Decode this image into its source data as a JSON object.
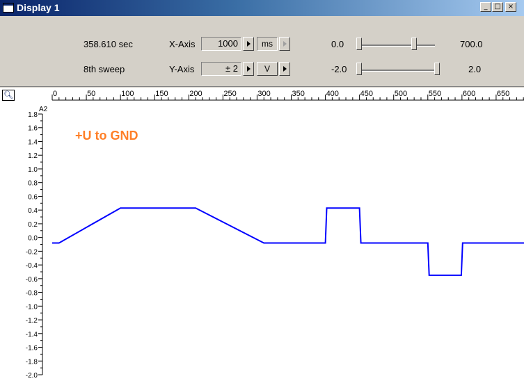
{
  "window": {
    "title": "Display 1",
    "buttons": {
      "minimize": "_",
      "maximize": "□",
      "close": "×"
    }
  },
  "toolbar": {
    "time": "358.610 sec",
    "sweep": "8th sweep",
    "x_axis": {
      "label": "X-Axis",
      "value": "1000",
      "unit": "ms"
    },
    "y_axis": {
      "label": "Y-Axis",
      "value": "± 2",
      "unit": "V"
    },
    "slider1": {
      "min": "0.0",
      "max": "700.0"
    },
    "slider2": {
      "min": "-2.0",
      "max": "2.0"
    }
  },
  "colors": {
    "trace": "#0000ff",
    "annotation": "#ff7f27",
    "accent": "#0a246a"
  },
  "icons": {
    "zoom": "magnifier-icon"
  },
  "chart_data": {
    "type": "line",
    "channel_label": "A2",
    "annotation": "+U to GND",
    "xlim": [
      0,
      700
    ],
    "ylim": [
      -2.0,
      1.8
    ],
    "x_ticks": [
      "0",
      "50",
      "100",
      "150",
      "200",
      "250",
      "300",
      "350",
      "400",
      "450",
      "500",
      "550",
      "600",
      "650"
    ],
    "y_ticks": [
      "1.8",
      "1.6",
      "1.4",
      "1.2",
      "1.0",
      "0.8",
      "0.6",
      "0.4",
      "0.2",
      "0.0",
      "-0.2",
      "-0.4",
      "-0.6",
      "-0.8",
      "-1.0",
      "-1.2",
      "-1.4",
      "-1.6",
      "-1.8",
      "-2.0"
    ],
    "series": [
      {
        "x": [
          0,
          10,
          100,
          210,
          310,
          400,
          402,
          450,
          452,
          550,
          552,
          599,
          601,
          700
        ],
        "y": [
          -0.08,
          -0.08,
          0.43,
          0.43,
          -0.08,
          -0.08,
          0.43,
          0.43,
          -0.08,
          -0.08,
          -0.55,
          -0.55,
          -0.08,
          -0.08
        ]
      }
    ]
  }
}
